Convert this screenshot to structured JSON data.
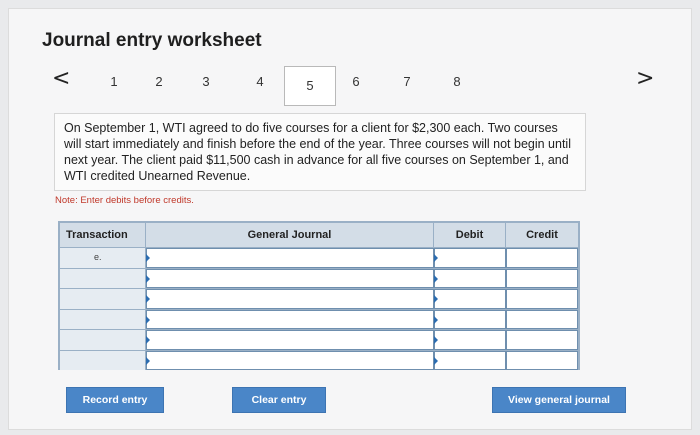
{
  "header": {
    "title": "Journal entry worksheet"
  },
  "pager": {
    "prev_icon": "<",
    "next_icon": ">",
    "pages": [
      "1",
      "2",
      "3",
      "4",
      "5",
      "6",
      "7",
      "8"
    ],
    "active_page": "5"
  },
  "prompt": {
    "text": "On September 1, WTI agreed to do five courses for a client for $2,300 each. Two courses will start immediately and finish before the end of the year. Three courses will not begin until next year. The client paid $11,500 cash in advance for all five courses on September 1, and WTI credited Unearned Revenue."
  },
  "note": "Note: Enter debits before credits.",
  "table": {
    "headers": [
      "Transaction",
      "General Journal",
      "Debit",
      "Credit"
    ],
    "rows": [
      {
        "transaction": "e.",
        "account": "",
        "debit": "",
        "credit": ""
      },
      {
        "transaction": "",
        "account": "",
        "debit": "",
        "credit": ""
      },
      {
        "transaction": "",
        "account": "",
        "debit": "",
        "credit": ""
      },
      {
        "transaction": "",
        "account": "",
        "debit": "",
        "credit": ""
      },
      {
        "transaction": "",
        "account": "",
        "debit": "",
        "credit": ""
      },
      {
        "transaction": "",
        "account": "",
        "debit": "",
        "credit": ""
      }
    ]
  },
  "buttons": {
    "record": "Record entry",
    "clear": "Clear entry",
    "view_general_journal": "View general journal"
  }
}
